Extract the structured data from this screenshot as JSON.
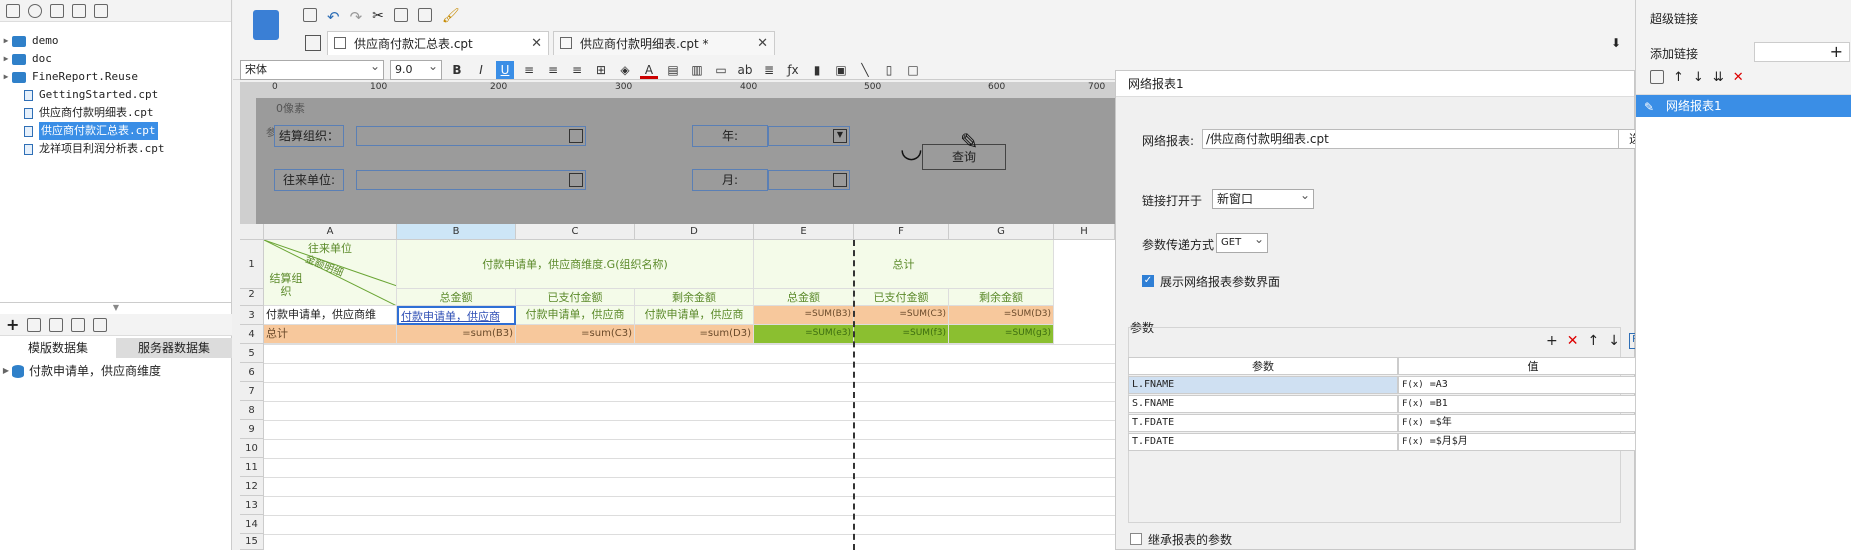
{
  "tree": {
    "items": [
      {
        "label": "demo",
        "type": "folder"
      },
      {
        "label": "doc",
        "type": "folder"
      },
      {
        "label": "FineReport.Reuse",
        "type": "folder"
      },
      {
        "label": "GettingStarted.cpt",
        "type": "file"
      },
      {
        "label": "供应商付款明细表.cpt",
        "type": "file"
      },
      {
        "label": "供应商付款汇总表.cpt",
        "type": "file",
        "selected": true
      },
      {
        "label": "龙祥项目利润分析表.cpt",
        "type": "file"
      }
    ]
  },
  "dataset": {
    "tabs": [
      "模版数据集",
      "服务器数据集"
    ],
    "items": [
      "付款申请单，供应商维度"
    ]
  },
  "tabs": [
    {
      "label": "供应商付款汇总表.cpt",
      "active": true
    },
    {
      "label": "供应商付款明细表.cpt *",
      "active": false
    }
  ],
  "format": {
    "font": "宋体",
    "size": "9.0"
  },
  "ruler": [
    "0",
    "100",
    "200",
    "300",
    "400",
    "500",
    "600",
    "700",
    "800"
  ],
  "param_pane": {
    "pixel_label": "0像素",
    "side_label": "参数",
    "labels": {
      "org": "结算组织：",
      "unit": "往来单位:",
      "year": "年:",
      "month": "月:"
    },
    "query": "查询"
  },
  "grid": {
    "columns": [
      "A",
      "B",
      "C",
      "D",
      "E",
      "F",
      "G",
      "H"
    ],
    "rows": [
      "1",
      "2",
      "3",
      "4",
      "5",
      "6",
      "7",
      "8",
      "9",
      "10",
      "11",
      "12",
      "13",
      "14",
      "15"
    ],
    "diag": {
      "top": "往来单位",
      "mid": "金额明细",
      "bottom": "结算组织"
    },
    "r1_bd": "付款申请单，供应商维度.G(组织名称)",
    "r1_total": "总计",
    "r2": [
      "总金额",
      "已支付金额",
      "剩余金额",
      "总金额",
      "已支付金额",
      "剩余金额"
    ],
    "r3": [
      "付款申请单，供应商维",
      "付款申请单，供应商",
      "付款申请单，供应商",
      "付款申请单，供应商",
      "=SUM(B3)",
      "=SUM(C3)",
      "=SUM(D3)"
    ],
    "r4": [
      "总计",
      "=sum(B3)",
      "=sum(C3)",
      "=sum(D3)",
      "=SUM(e3)",
      "=SUM(f3)",
      "=SUM(g3)"
    ]
  },
  "dialog": {
    "title": "网络报表1",
    "report_label": "网络报表:",
    "report_value": "/供应商付款明细表.cpt",
    "choose": "选择",
    "open_label": "链接打开于",
    "open_value": "新窗口",
    "method_label": "参数传递方式",
    "method_value": "GET",
    "show_params": "展示网络报表参数界面",
    "params_title": "参数",
    "headers": [
      "参数",
      "值"
    ],
    "params": [
      {
        "name": "L.FNAME",
        "value": "=A3"
      },
      {
        "name": "S.FNAME",
        "value": "=B1"
      },
      {
        "name": "T.FDATE",
        "value": "=$年"
      },
      {
        "name": "T.FDATE",
        "value": "=$月$月"
      }
    ],
    "inherit": "继承报表的参数"
  },
  "right": {
    "title": "超级链接",
    "add_label": "添加链接",
    "items": [
      "网络报表1"
    ]
  }
}
